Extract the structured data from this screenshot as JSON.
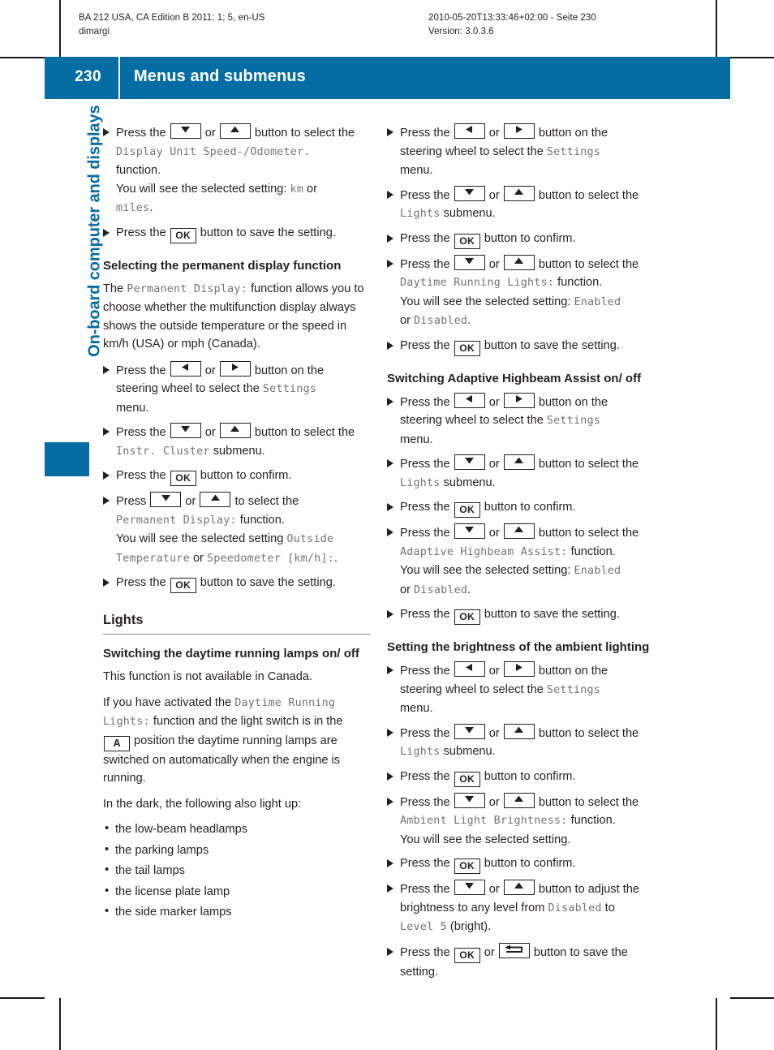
{
  "running_header": {
    "left_line1": "BA 212 USA, CA Edition B 2011; 1; 5, en-US",
    "left_line2": "dimargi",
    "right_line1": "2010-05-20T13:33:46+02:00 - Seite 230",
    "right_line2": "Version: 3.0.3.6"
  },
  "title_bar": {
    "page_number": "230",
    "chapter_title": "Menus and submenus",
    "accent_color": "#056da3"
  },
  "side_title": "On-board computer and displays",
  "keys": {
    "down": "down-arrow-button",
    "up": "up-arrow-button",
    "left": "left-arrow-button",
    "right": "right-arrow-button",
    "ok": "OK",
    "auto": "A",
    "back": "back-button"
  },
  "left_column": {
    "steps_top": [
      {
        "lines": [
          [
            {
              "t": "text",
              "v": "Press the "
            },
            {
              "t": "key",
              "v": "down"
            },
            {
              "t": "text",
              "v": " or "
            },
            {
              "t": "key",
              "v": "up"
            },
            {
              "t": "text",
              "v": " button to select the "
            }
          ],
          [
            {
              "t": "mono",
              "v": "Display Unit Speed-/Odometer."
            }
          ],
          [
            {
              "t": "text",
              "v": "function."
            }
          ],
          [
            {
              "t": "text",
              "v": "You will see the selected setting: "
            },
            {
              "t": "mono",
              "v": "km"
            },
            {
              "t": "text",
              "v": " or"
            }
          ],
          [
            {
              "t": "mono",
              "v": "miles"
            },
            {
              "t": "text",
              "v": "."
            }
          ]
        ]
      },
      {
        "lines": [
          [
            {
              "t": "text",
              "v": "Press the "
            },
            {
              "t": "key",
              "v": "ok"
            },
            {
              "t": "text",
              "v": " button to save the setting."
            }
          ]
        ]
      }
    ],
    "heading_permanent": "Selecting the permanent display function",
    "para_permanent": [
      {
        "t": "text",
        "v": "The "
      },
      {
        "t": "mono",
        "v": "Permanent Display:"
      },
      {
        "t": "text",
        "v": " function allows you to choose whether the multifunction display always shows the outside temperature or the speed in km/h (USA) or mph (Canada)."
      }
    ],
    "steps_permanent": [
      {
        "lines": [
          [
            {
              "t": "text",
              "v": "Press the "
            },
            {
              "t": "key",
              "v": "left"
            },
            {
              "t": "text",
              "v": " or "
            },
            {
              "t": "key",
              "v": "right"
            },
            {
              "t": "text",
              "v": " button on the"
            }
          ],
          [
            {
              "t": "text",
              "v": "steering wheel to select the "
            },
            {
              "t": "mono",
              "v": "Settings"
            }
          ],
          [
            {
              "t": "text",
              "v": "menu."
            }
          ]
        ]
      },
      {
        "lines": [
          [
            {
              "t": "text",
              "v": "Press the "
            },
            {
              "t": "key",
              "v": "down"
            },
            {
              "t": "text",
              "v": " or "
            },
            {
              "t": "key",
              "v": "up"
            },
            {
              "t": "text",
              "v": " button to select the"
            }
          ],
          [
            {
              "t": "mono",
              "v": "Instr. Cluster"
            },
            {
              "t": "text",
              "v": " submenu."
            }
          ]
        ]
      },
      {
        "lines": [
          [
            {
              "t": "text",
              "v": "Press the "
            },
            {
              "t": "key",
              "v": "ok"
            },
            {
              "t": "text",
              "v": " button to confirm."
            }
          ]
        ]
      },
      {
        "lines": [
          [
            {
              "t": "text",
              "v": "Press "
            },
            {
              "t": "key",
              "v": "down"
            },
            {
              "t": "text",
              "v": " or "
            },
            {
              "t": "key",
              "v": "up"
            },
            {
              "t": "text",
              "v": " to select the"
            }
          ],
          [
            {
              "t": "mono",
              "v": "Permanent Display:"
            },
            {
              "t": "text",
              "v": " function."
            }
          ],
          [
            {
              "t": "text",
              "v": "You will see the selected setting "
            },
            {
              "t": "mono",
              "v": "Outside"
            }
          ],
          [
            {
              "t": "mono",
              "v": "Temperature"
            },
            {
              "t": "text",
              "v": " or "
            },
            {
              "t": "mono",
              "v": "Speedometer [km/h]:"
            },
            {
              "t": "text",
              "v": "."
            }
          ]
        ]
      },
      {
        "lines": [
          [
            {
              "t": "text",
              "v": "Press the "
            },
            {
              "t": "key",
              "v": "ok"
            },
            {
              "t": "text",
              "v": " button to save the setting."
            }
          ]
        ]
      }
    ],
    "section_heading_lights": "Lights",
    "heading_daytime": "Switching the daytime running lamps on/ off",
    "para_canada": "This function is not available in Canada.",
    "para_activated": [
      {
        "t": "text",
        "v": "If you have activated the "
      },
      {
        "t": "mono",
        "v": "Daytime Running Lights:"
      },
      {
        "t": "text",
        "v": " function and the light switch is in the "
      },
      {
        "t": "key",
        "v": "auto"
      },
      {
        "t": "text",
        "v": " position the daytime running lamps are switched on automatically when the engine is running."
      }
    ],
    "para_dark": "In the dark, the following also light up:",
    "bullets": [
      "the low-beam headlamps",
      "the parking lamps",
      "the tail lamps",
      "the license plate lamp",
      "the side marker lamps"
    ]
  },
  "right_column": {
    "steps_daytime": [
      {
        "lines": [
          [
            {
              "t": "text",
              "v": "Press the "
            },
            {
              "t": "key",
              "v": "left"
            },
            {
              "t": "text",
              "v": " or "
            },
            {
              "t": "key",
              "v": "right"
            },
            {
              "t": "text",
              "v": " button on the"
            }
          ],
          [
            {
              "t": "text",
              "v": "steering wheel to select the "
            },
            {
              "t": "mono",
              "v": "Settings"
            }
          ],
          [
            {
              "t": "text",
              "v": "menu."
            }
          ]
        ]
      },
      {
        "lines": [
          [
            {
              "t": "text",
              "v": "Press the "
            },
            {
              "t": "key",
              "v": "down"
            },
            {
              "t": "text",
              "v": " or "
            },
            {
              "t": "key",
              "v": "up"
            },
            {
              "t": "text",
              "v": " button to select the"
            }
          ],
          [
            {
              "t": "mono",
              "v": "Lights"
            },
            {
              "t": "text",
              "v": " submenu."
            }
          ]
        ]
      },
      {
        "lines": [
          [
            {
              "t": "text",
              "v": "Press the "
            },
            {
              "t": "key",
              "v": "ok"
            },
            {
              "t": "text",
              "v": " button to confirm."
            }
          ]
        ]
      },
      {
        "lines": [
          [
            {
              "t": "text",
              "v": "Press the "
            },
            {
              "t": "key",
              "v": "down"
            },
            {
              "t": "text",
              "v": " or "
            },
            {
              "t": "key",
              "v": "up"
            },
            {
              "t": "text",
              "v": " button to select the"
            }
          ],
          [
            {
              "t": "mono",
              "v": "Daytime Running Lights:"
            },
            {
              "t": "text",
              "v": " function."
            }
          ],
          [
            {
              "t": "text",
              "v": "You will see the selected setting: "
            },
            {
              "t": "mono",
              "v": "Enabled"
            }
          ],
          [
            {
              "t": "text",
              "v": "or "
            },
            {
              "t": "mono",
              "v": "Disabled"
            },
            {
              "t": "text",
              "v": "."
            }
          ]
        ]
      },
      {
        "lines": [
          [
            {
              "t": "text",
              "v": "Press the "
            },
            {
              "t": "key",
              "v": "ok"
            },
            {
              "t": "text",
              "v": " button to save the setting."
            }
          ]
        ]
      }
    ],
    "heading_highbeam": "Switching Adaptive Highbeam Assist on/ off",
    "steps_highbeam": [
      {
        "lines": [
          [
            {
              "t": "text",
              "v": "Press the "
            },
            {
              "t": "key",
              "v": "left"
            },
            {
              "t": "text",
              "v": " or "
            },
            {
              "t": "key",
              "v": "right"
            },
            {
              "t": "text",
              "v": " button on the"
            }
          ],
          [
            {
              "t": "text",
              "v": "steering wheel to select the "
            },
            {
              "t": "mono",
              "v": "Settings"
            }
          ],
          [
            {
              "t": "text",
              "v": "menu."
            }
          ]
        ]
      },
      {
        "lines": [
          [
            {
              "t": "text",
              "v": "Press the "
            },
            {
              "t": "key",
              "v": "down"
            },
            {
              "t": "text",
              "v": " or "
            },
            {
              "t": "key",
              "v": "up"
            },
            {
              "t": "text",
              "v": " button to select the"
            }
          ],
          [
            {
              "t": "mono",
              "v": "Lights"
            },
            {
              "t": "text",
              "v": " submenu."
            }
          ]
        ]
      },
      {
        "lines": [
          [
            {
              "t": "text",
              "v": "Press the "
            },
            {
              "t": "key",
              "v": "ok"
            },
            {
              "t": "text",
              "v": " button to confirm."
            }
          ]
        ]
      },
      {
        "lines": [
          [
            {
              "t": "text",
              "v": "Press the "
            },
            {
              "t": "key",
              "v": "down"
            },
            {
              "t": "text",
              "v": " or "
            },
            {
              "t": "key",
              "v": "up"
            },
            {
              "t": "text",
              "v": " button to select the"
            }
          ],
          [
            {
              "t": "mono",
              "v": "Adaptive Highbeam Assist:"
            },
            {
              "t": "text",
              "v": " function."
            }
          ],
          [
            {
              "t": "text",
              "v": "You will see the selected setting: "
            },
            {
              "t": "mono",
              "v": "Enabled"
            }
          ],
          [
            {
              "t": "text",
              "v": "or "
            },
            {
              "t": "mono",
              "v": "Disabled"
            },
            {
              "t": "text",
              "v": "."
            }
          ]
        ]
      },
      {
        "lines": [
          [
            {
              "t": "text",
              "v": "Press the "
            },
            {
              "t": "key",
              "v": "ok"
            },
            {
              "t": "text",
              "v": " button to save the setting."
            }
          ]
        ]
      }
    ],
    "heading_ambient": "Setting the brightness of the ambient lighting",
    "steps_ambient": [
      {
        "lines": [
          [
            {
              "t": "text",
              "v": "Press the "
            },
            {
              "t": "key",
              "v": "left"
            },
            {
              "t": "text",
              "v": " or "
            },
            {
              "t": "key",
              "v": "right"
            },
            {
              "t": "text",
              "v": " button on the"
            }
          ],
          [
            {
              "t": "text",
              "v": "steering wheel to select the "
            },
            {
              "t": "mono",
              "v": "Settings"
            }
          ],
          [
            {
              "t": "text",
              "v": "menu."
            }
          ]
        ]
      },
      {
        "lines": [
          [
            {
              "t": "text",
              "v": "Press the "
            },
            {
              "t": "key",
              "v": "down"
            },
            {
              "t": "text",
              "v": " or "
            },
            {
              "t": "key",
              "v": "up"
            },
            {
              "t": "text",
              "v": " button to select the"
            }
          ],
          [
            {
              "t": "mono",
              "v": "Lights"
            },
            {
              "t": "text",
              "v": " submenu."
            }
          ]
        ]
      },
      {
        "lines": [
          [
            {
              "t": "text",
              "v": "Press the "
            },
            {
              "t": "key",
              "v": "ok"
            },
            {
              "t": "text",
              "v": " button to confirm."
            }
          ]
        ]
      },
      {
        "lines": [
          [
            {
              "t": "text",
              "v": "Press the "
            },
            {
              "t": "key",
              "v": "down"
            },
            {
              "t": "text",
              "v": " or "
            },
            {
              "t": "key",
              "v": "up"
            },
            {
              "t": "text",
              "v": " button to select the"
            }
          ],
          [
            {
              "t": "mono",
              "v": "Ambient Light Brightness:"
            },
            {
              "t": "text",
              "v": " function."
            }
          ],
          [
            {
              "t": "text",
              "v": "You will see the selected setting."
            }
          ]
        ]
      },
      {
        "lines": [
          [
            {
              "t": "text",
              "v": "Press the "
            },
            {
              "t": "key",
              "v": "ok"
            },
            {
              "t": "text",
              "v": " button to confirm."
            }
          ]
        ]
      },
      {
        "lines": [
          [
            {
              "t": "text",
              "v": "Press the "
            },
            {
              "t": "key",
              "v": "down"
            },
            {
              "t": "text",
              "v": " or "
            },
            {
              "t": "key",
              "v": "up"
            },
            {
              "t": "text",
              "v": " button to adjust the"
            }
          ],
          [
            {
              "t": "text",
              "v": "brightness to any level from "
            },
            {
              "t": "mono",
              "v": "Disabled"
            },
            {
              "t": "text",
              "v": " to"
            }
          ],
          [
            {
              "t": "mono",
              "v": "Level 5"
            },
            {
              "t": "text",
              "v": " (bright)."
            }
          ]
        ]
      },
      {
        "lines": [
          [
            {
              "t": "text",
              "v": "Press the "
            },
            {
              "t": "key",
              "v": "ok"
            },
            {
              "t": "text",
              "v": " or "
            },
            {
              "t": "key",
              "v": "back"
            },
            {
              "t": "text",
              "v": " button to save the"
            }
          ],
          [
            {
              "t": "text",
              "v": "setting."
            }
          ]
        ]
      }
    ]
  }
}
